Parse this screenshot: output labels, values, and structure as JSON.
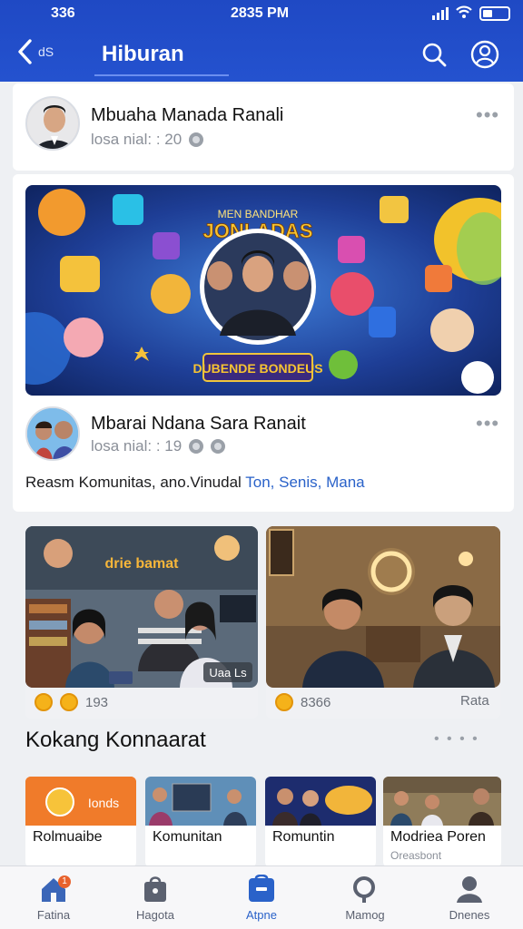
{
  "status": {
    "time_left": "336",
    "time_center": "2835 PM"
  },
  "header": {
    "back_label": "dS",
    "title": "Hiburan"
  },
  "post1": {
    "author": "Mbuaha Manada Ranali",
    "meta": "losa nial: : 20"
  },
  "post2": {
    "author": "Mbarai Ndana Sara Ranait",
    "meta": "losa nial: : 19",
    "text_plain": "Reasm Komunitas, ano.Vinudal ",
    "text_links": "Ton, Senis, Mana",
    "banner_title": "JONLADAS",
    "banner_subtitle": "DUBENDE BONDEUS"
  },
  "media_left": {
    "overlay": "Uaa Ls",
    "sign": "drie bamat",
    "reaction_count": "193"
  },
  "media_right": {
    "reaction_count": "8366",
    "reaction_label": "Rata"
  },
  "section": {
    "title": "Kokang Konnaarat",
    "more": "• • • •"
  },
  "tiles": [
    {
      "thumb_label": "Ionds",
      "label": "Rolmuaibe",
      "sub": ""
    },
    {
      "thumb_label": "",
      "label": "Komunitan",
      "sub": ""
    },
    {
      "thumb_label": "",
      "label": "Romuntin",
      "sub": ""
    },
    {
      "thumb_label": "",
      "label": "Modriea Poren",
      "sub": "Oreasbont"
    }
  ],
  "tabs": [
    {
      "label": "Fatina",
      "badge": "1"
    },
    {
      "label": "Hagota"
    },
    {
      "label": "Atpne"
    },
    {
      "label": "Mamog"
    },
    {
      "label": "Dnenes"
    }
  ],
  "colors": {
    "header": "#2452cf",
    "link": "#2a62c9",
    "badge": "#e8622d"
  }
}
